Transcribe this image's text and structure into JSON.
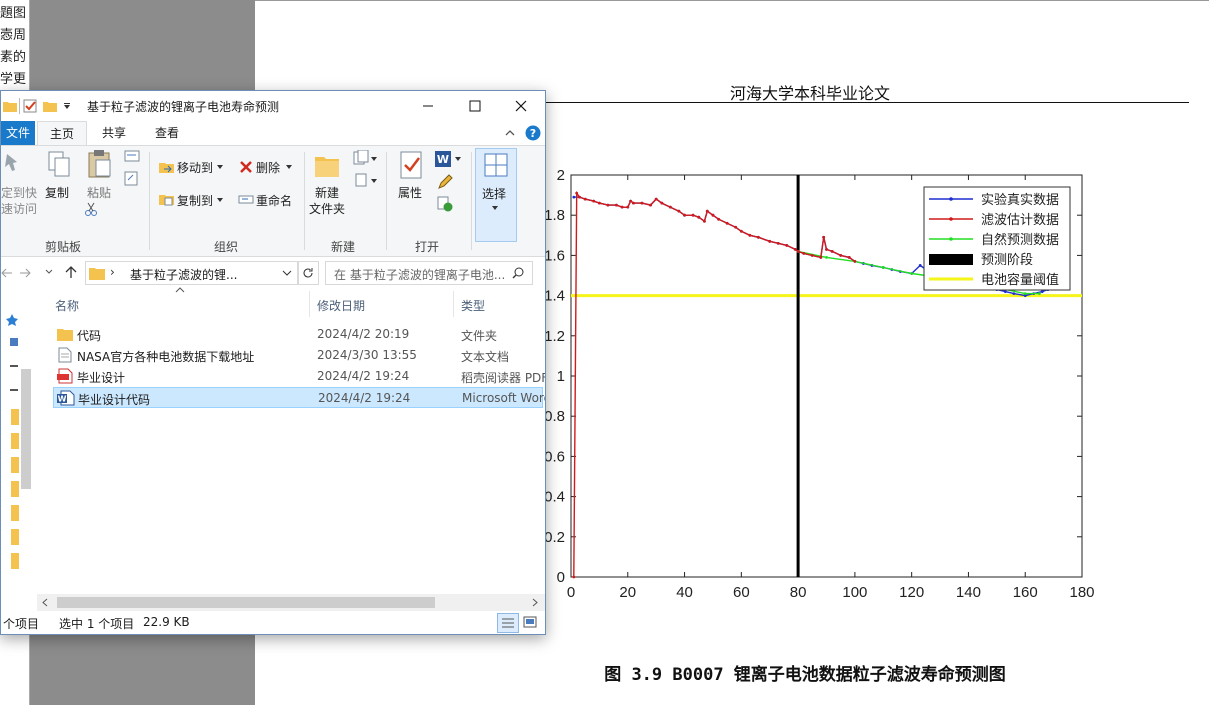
{
  "left_strip_texts": [
    "題图",
    "悫周",
    "素的",
    "学更"
  ],
  "document": {
    "header": "河海大学本科毕业论文",
    "caption": "图 3.9 B0007 锂离子电池数据粒子滤波寿命预测图"
  },
  "chart_data": {
    "type": "line",
    "title": "",
    "xlabel": "",
    "ylabel": "",
    "xlim": [
      0,
      180
    ],
    "ylim": [
      0,
      2
    ],
    "xticks": [
      0,
      20,
      40,
      60,
      80,
      100,
      120,
      140,
      160,
      180
    ],
    "yticks": [
      0,
      0.2,
      0.4,
      0.6,
      0.8,
      1,
      1.2,
      1.4,
      1.6,
      1.8,
      2
    ],
    "ytick_labels": [
      "0",
      "0.2",
      "0.4",
      "0.6",
      "0.8",
      "1",
      "1.2",
      "1.4",
      "1.6",
      "1.8",
      "2"
    ],
    "legend_position": "top-right",
    "series": [
      {
        "name": "实验真实数据",
        "color": "#1f2fd0",
        "marker": "dot",
        "x": [
          1,
          3,
          5,
          8,
          10,
          13,
          16,
          18,
          20,
          21,
          22,
          25,
          28,
          30,
          32,
          35,
          38,
          40,
          43,
          45,
          47,
          48,
          50,
          52,
          55,
          58,
          60,
          63,
          66,
          70,
          73,
          76,
          79,
          80,
          82,
          85,
          88,
          89,
          90,
          92,
          95,
          98,
          100,
          103,
          106,
          110,
          113,
          116,
          120,
          123,
          126,
          130,
          133,
          136,
          140,
          143,
          146,
          150,
          153,
          156,
          160,
          163,
          166,
          168
        ],
        "y": [
          1.89,
          1.89,
          1.88,
          1.87,
          1.86,
          1.85,
          1.85,
          1.84,
          1.84,
          1.87,
          1.86,
          1.86,
          1.85,
          1.88,
          1.86,
          1.84,
          1.82,
          1.8,
          1.8,
          1.79,
          1.77,
          1.82,
          1.8,
          1.78,
          1.76,
          1.74,
          1.72,
          1.7,
          1.69,
          1.67,
          1.66,
          1.65,
          1.63,
          1.62,
          1.61,
          1.6,
          1.59,
          1.69,
          1.63,
          1.62,
          1.6,
          1.59,
          1.57,
          1.56,
          1.55,
          1.54,
          1.53,
          1.52,
          1.51,
          1.55,
          1.52,
          1.5,
          1.49,
          1.48,
          1.47,
          1.46,
          1.44,
          1.43,
          1.42,
          1.41,
          1.4,
          1.41,
          1.42,
          1.43
        ]
      },
      {
        "name": "滤波估计数据",
        "color": "#d11a1a",
        "marker": "dot",
        "x": [
          1,
          2,
          3,
          5,
          8,
          10,
          13,
          16,
          18,
          20,
          21,
          22,
          25,
          28,
          30,
          32,
          35,
          38,
          40,
          43,
          45,
          47,
          48,
          50,
          52,
          55,
          58,
          60,
          63,
          66,
          70,
          73,
          76,
          79,
          80,
          82,
          85,
          88,
          89,
          90,
          92,
          95,
          98,
          100
        ],
        "y": [
          0.0,
          1.91,
          1.89,
          1.88,
          1.87,
          1.86,
          1.85,
          1.85,
          1.84,
          1.84,
          1.87,
          1.86,
          1.86,
          1.85,
          1.88,
          1.86,
          1.84,
          1.82,
          1.8,
          1.8,
          1.79,
          1.77,
          1.82,
          1.8,
          1.78,
          1.76,
          1.74,
          1.72,
          1.7,
          1.69,
          1.67,
          1.66,
          1.65,
          1.63,
          1.62,
          1.61,
          1.6,
          1.59,
          1.69,
          1.63,
          1.62,
          1.6,
          1.59,
          1.57
        ]
      },
      {
        "name": "自然预测数据",
        "color": "#22dd22",
        "marker": "dot",
        "x": [
          80,
          90,
          100,
          110,
          120,
          130,
          140,
          150,
          160,
          165
        ],
        "y": [
          1.62,
          1.59,
          1.57,
          1.54,
          1.51,
          1.49,
          1.46,
          1.44,
          1.41,
          1.41
        ]
      },
      {
        "name": "预测阶段",
        "color": "#000000",
        "marker": "none",
        "x": [
          80,
          80
        ],
        "y": [
          0,
          2
        ]
      },
      {
        "name": "电池容量阈值",
        "color": "#f5f51a",
        "marker": "none",
        "x": [
          0,
          180
        ],
        "y": [
          1.4,
          1.4
        ]
      }
    ]
  },
  "explorer": {
    "title": "基于粒子滤波的锂离子电池寿命预测",
    "tabs": {
      "file": "文件",
      "home": "主页",
      "share": "共享",
      "view": "查看"
    },
    "ribbon": {
      "pin_label_1": "定到快",
      "pin_label_2": "速访问",
      "copy": "复制",
      "paste": "粘贴",
      "move_to": "移动到",
      "copy_to": "复制到",
      "delete": "删除",
      "rename": "重命名",
      "new_folder_1": "新建",
      "new_folder_2": "文件夹",
      "properties": "属性",
      "select": "选择",
      "group_clipboard": "剪贴板",
      "group_organize": "组织",
      "group_new": "新建",
      "group_open": "打开"
    },
    "address": "基于粒子滤波的锂...",
    "search_placeholder": "在 基于粒子滤波的锂离子电池...",
    "columns": {
      "name": "名称",
      "modified": "修改日期",
      "type": "类型"
    },
    "files": [
      {
        "name": "代码",
        "date": "2024/4/2 20:19",
        "type": "文件夹",
        "icon": "folder-icon"
      },
      {
        "name": "NASA官方各种电池数据下载地址",
        "date": "2024/3/30 13:55",
        "type": "文本文档",
        "icon": "text-file-icon"
      },
      {
        "name": "毕业设计",
        "date": "2024/4/2 19:24",
        "type": "稻壳阅读器 PDF",
        "icon": "pdf-file-icon"
      },
      {
        "name": "毕业设计代码",
        "date": "2024/4/2 19:24",
        "type": "Microsoft Word",
        "icon": "word-file-icon"
      }
    ],
    "status": {
      "count": "个项目",
      "selected": "选中 1 个项目",
      "size": "22.9 KB"
    }
  }
}
